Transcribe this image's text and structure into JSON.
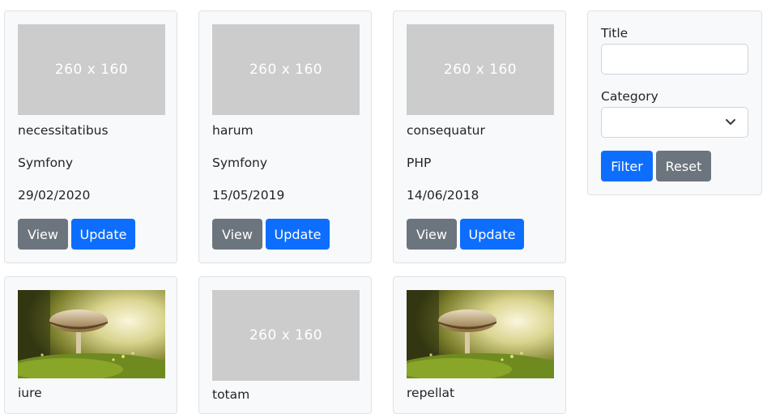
{
  "cards": [
    {
      "title": "necessitatibus",
      "category": "Symfony",
      "date": "29/02/2020",
      "image": {
        "kind": "placeholder",
        "label": "260 x 160"
      },
      "view_label": "View",
      "update_label": "Update"
    },
    {
      "title": "harum",
      "category": "Symfony",
      "date": "15/05/2019",
      "image": {
        "kind": "placeholder",
        "label": "260 x 160"
      },
      "view_label": "View",
      "update_label": "Update"
    },
    {
      "title": "consequatur",
      "category": "PHP",
      "date": "14/06/2018",
      "image": {
        "kind": "placeholder",
        "label": "260 x 160"
      },
      "view_label": "View",
      "update_label": "Update"
    },
    {
      "title": "iure",
      "category": "",
      "date": "",
      "image": {
        "kind": "photo",
        "subject": "mushroom-photo"
      },
      "view_label": "",
      "update_label": ""
    },
    {
      "title": "totam",
      "category": "",
      "date": "",
      "image": {
        "kind": "placeholder",
        "label": "260 x 160"
      },
      "view_label": "",
      "update_label": ""
    },
    {
      "title": "repellat",
      "category": "",
      "date": "",
      "image": {
        "kind": "photo",
        "subject": "mushroom-photo"
      },
      "view_label": "",
      "update_label": ""
    }
  ],
  "filter": {
    "title_label": "Title",
    "title_value": "",
    "category_label": "Category",
    "category_value": "",
    "filter_label": "Filter",
    "reset_label": "Reset"
  },
  "colors": {
    "primary": "#0d6efd",
    "secondary": "#6c757d",
    "placeholder_bg": "#cccccc",
    "card_bg": "#f8f9fa",
    "border": "#dee2e6"
  }
}
